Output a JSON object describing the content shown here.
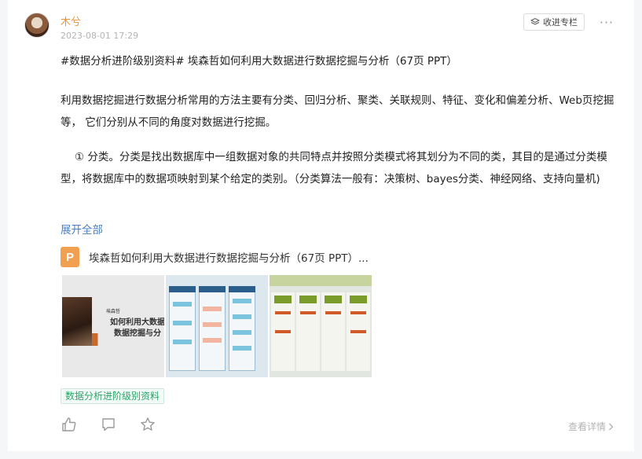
{
  "post": {
    "author": "木兮",
    "time": "2023-08-01 17:29",
    "collect_label": "收进专栏",
    "more_label": "···",
    "title": "#数据分析进阶级别资料# 埃森哲如何利用大数据进行数据挖掘与分析（67页 PPT）",
    "paragraph1": "利用数据挖掘进行数据分析常用的方法主要有分类、回归分析、聚类、关联规则、特征、变化和偏差分析、Web页挖掘等， 它们分别从不同的角度对数据进行挖掘。",
    "paragraph2": "① 分类。分类是找出数据库中一组数据对象的共同特点并按照分类模式将其划分为不同的类，其目的是通过分类模型，将数据库中的数据项映射到某个给定的类别。（分类算法一般有：决策树、bayes分类、神经网络、支持向量机)",
    "expand_label": "展开全部",
    "attachment": {
      "icon_letter": "P",
      "name": "埃森哲如何利用大数据进行数据挖掘与分析（67页 PPT）..."
    },
    "thumb1": {
      "small_text": "埃森哲",
      "line1": "如何利用大数据",
      "line2": "数据挖掘与分"
    },
    "tag": "数据分析进阶级别资料",
    "detail_label": "查看详情"
  },
  "icons": {
    "collect": "bookmark-stack-icon",
    "like": "thumbs-up-icon",
    "comment": "comment-icon",
    "star": "star-icon",
    "chevron": "chevron-right-icon"
  },
  "colors": {
    "author": "#e9953e",
    "link": "#4a7fc1",
    "tag": "#2aa46b",
    "ppt": "#f0a050"
  }
}
